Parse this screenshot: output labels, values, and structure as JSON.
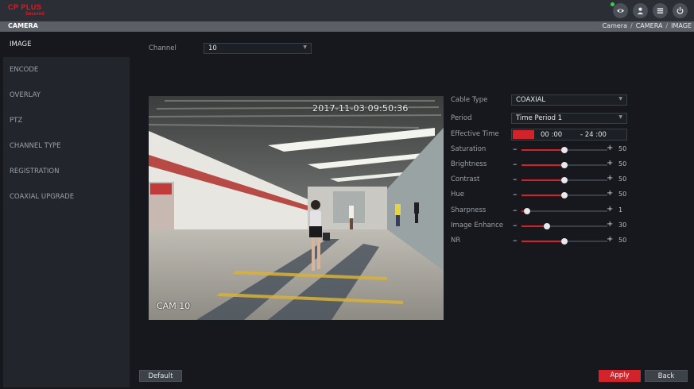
{
  "brand": {
    "name": "CP PLUS",
    "sub": "Secured"
  },
  "header": {
    "section_title": "CAMERA",
    "breadcrumb": [
      "Camera",
      "CAMERA",
      "IMAGE"
    ]
  },
  "sidebar": {
    "items": [
      {
        "label": "IMAGE",
        "active": true
      },
      {
        "label": "ENCODE"
      },
      {
        "label": "OVERLAY"
      },
      {
        "label": "PTZ"
      },
      {
        "label": "CHANNEL TYPE"
      },
      {
        "label": "REGISTRATION"
      },
      {
        "label": "COAXIAL UPGRADE"
      }
    ]
  },
  "channel": {
    "label": "Channel",
    "value": "10"
  },
  "preview": {
    "timestamp": "2017-11-03 09:50:36",
    "camera_label": "CAM 10"
  },
  "settings": {
    "cable_type": {
      "label": "Cable Type",
      "value": "COAXIAL"
    },
    "period": {
      "label": "Period",
      "value": "Time Period 1"
    },
    "effective_time": {
      "label": "Effective Time",
      "start": "00 :00",
      "end": "- 24 :00"
    },
    "sliders": [
      {
        "label": "Saturation",
        "value": 50,
        "max": 100
      },
      {
        "label": "Brightness",
        "value": 50,
        "max": 100
      },
      {
        "label": "Contrast",
        "value": 50,
        "max": 100
      },
      {
        "label": "Hue",
        "value": 50,
        "max": 100
      },
      {
        "label": "Sharpness",
        "value": 1,
        "max": 15
      },
      {
        "label": "Image Enhance",
        "value": 30,
        "max": 100
      },
      {
        "label": "NR",
        "value": 50,
        "max": 100
      }
    ]
  },
  "buttons": {
    "default": "Default",
    "apply": "Apply",
    "back": "Back"
  },
  "colors": {
    "accent": "#d2232a",
    "status_online": "#3ccf4e"
  },
  "icons": [
    "eye-icon",
    "user-icon",
    "list-icon",
    "power-icon"
  ]
}
